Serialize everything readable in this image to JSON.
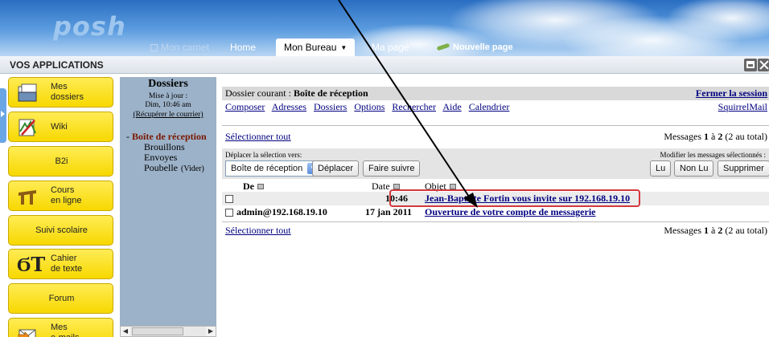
{
  "header": {
    "logo": "posh",
    "nav": {
      "carnet": "Mon carnet",
      "home": "Home",
      "bureau": "Mon Bureau",
      "ma_page": "Ma page",
      "nouvelle_page": "Nouvelle page"
    }
  },
  "apps_bar": {
    "title": "VOS APPLICATIONS"
  },
  "apps": [
    {
      "label_1": "Mes",
      "label_2": "dossiers",
      "icon": "folder-icon"
    },
    {
      "label_1": "Wiki",
      "label_2": "",
      "icon": "wiki-icon"
    },
    {
      "label_1": "B2i",
      "label_2": "",
      "icon": ""
    },
    {
      "label_1": "Cours",
      "label_2": "en ligne",
      "icon": "courses-icon"
    },
    {
      "label_1": "Suivi scolaire",
      "label_2": "",
      "icon": ""
    },
    {
      "label_1": "Cahier",
      "label_2": "de texte",
      "icon": "textbook-icon",
      "glyph": "ϬT"
    },
    {
      "label_1": "Forum",
      "label_2": "",
      "icon": ""
    },
    {
      "label_1": "Mes",
      "label_2": "e-mails",
      "icon": "email-icon"
    }
  ],
  "dossiers": {
    "title": "Dossiers",
    "update_label": "Mise à jour :",
    "update_time": "Dim, 10:46 am",
    "fetch_link": "(Récupérer le courrier)",
    "inbox_marker": "-",
    "folders": {
      "inbox": "Boîte de réception",
      "drafts": "Brouillons",
      "sent": "Envoyes",
      "trash": "Poubelle",
      "empty": "(Vider)"
    }
  },
  "mail": {
    "current_label": "Dossier courant :",
    "current_folder": "Boîte de réception",
    "logout": "Fermer la session",
    "menu": {
      "compose": "Composer",
      "addresses": "Adresses",
      "folders": "Dossiers",
      "options": "Options",
      "search": "Rechercher",
      "help": "Aide",
      "calendar": "Calendrier",
      "brand": "SquirrelMail"
    },
    "select_all": "Sélectionner tout",
    "count_prefix": "Messages",
    "count_first": "1",
    "count_mid": "à",
    "count_last": "2",
    "count_total": "(2 au total)",
    "move_label": "Déplacer la sélection vers:",
    "modify_label": "Modifier les messages sélectionnés :",
    "folder_select": "Boîte de réception",
    "buttons": {
      "move": "Déplacer",
      "forward": "Faire suivre",
      "read": "Lu",
      "unread": "Non Lu",
      "delete": "Supprimer"
    },
    "columns": {
      "from": "De",
      "date": "Date",
      "subject": "Objet"
    },
    "messages": [
      {
        "from": "",
        "date": "10:46",
        "subject": "Jean-Baptiste Fortin vous invite sur 192.168.19.10"
      },
      {
        "from": "admin@192.168.19.10",
        "date": "17 jan 2011",
        "subject": "Ouverture de votre compte de messagerie"
      }
    ]
  }
}
